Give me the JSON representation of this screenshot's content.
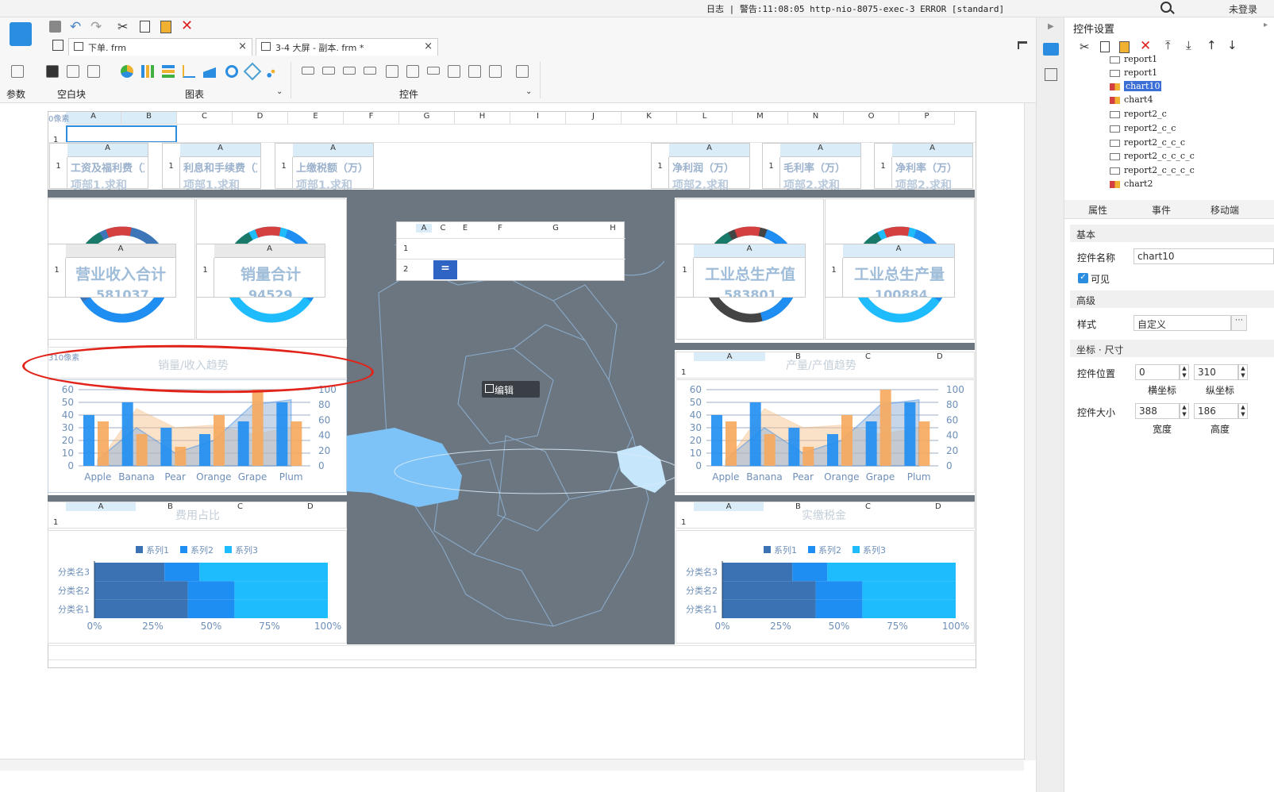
{
  "topbar": {
    "log": "日志 | 警告:11:08:05 http-nio-8075-exec-3 ERROR [standard]",
    "login": "未登录"
  },
  "tabs": [
    {
      "label": "下单. frm"
    },
    {
      "label": "3-4 大屏 - 副本. frm *"
    }
  ],
  "ribbon": {
    "params": "参数",
    "blank": "空白块",
    "charts": "图表",
    "controls": "控件"
  },
  "sheet": {
    "cols": [
      "A",
      "B",
      "C",
      "D",
      "E",
      "F",
      "G",
      "H",
      "I",
      "J",
      "K",
      "L",
      "M",
      "N",
      "O",
      "P"
    ],
    "top_label": "0像素",
    "row1": "1",
    "mini_tables_top": [
      {
        "h": "A",
        "r": "1",
        "t": "工资及福利费（万",
        "t2": "项部1.求和"
      },
      {
        "h": "A",
        "r": "1",
        "t": "利息和手续费（万",
        "t2": "项部1.求和"
      },
      {
        "h": "A",
        "r": "1",
        "t": "上缴税额（万）",
        "t2": "项部1.求和"
      },
      {
        "h": "A",
        "r": "1",
        "t": "净利润（万）",
        "t2": "项部2.求和"
      },
      {
        "h": "A",
        "r": "1",
        "t": "毛利率（万）",
        "t2": "项部2.求和"
      },
      {
        "h": "A",
        "r": "1",
        "t": "净利率（万）",
        "t2": "项部2.求和"
      }
    ],
    "kpis": [
      {
        "h": "A",
        "r1": "1",
        "r2": "2",
        "title": "营业收入合计",
        "value": "581037"
      },
      {
        "h": "A",
        "r1": "1",
        "r2": "2",
        "title": "销量合计",
        "value": "94529"
      },
      {
        "h": "A",
        "r1": "1",
        "r2": "2",
        "title": "工业总生产值",
        "value": "583801"
      },
      {
        "h": "A",
        "r1": "1",
        "r2": "2",
        "title": "工业总生产量",
        "value": "100884"
      }
    ],
    "center_table": {
      "cols": [
        "A",
        "C",
        "E",
        "F",
        "G",
        "H"
      ],
      "rows": [
        "1",
        "2"
      ],
      "cell": "="
    },
    "edit_button": "编辑",
    "label_310": "310像素",
    "trend_left": "销量/收入趋势",
    "trend_right": "产量/产值趋势",
    "cost_left": "费用占比",
    "cost_right": "实缴税金",
    "hdr_small": {
      "a": "A",
      "b": "B",
      "c": "C",
      "d": "D",
      "r": "1"
    }
  },
  "combo_chart": {
    "categories": [
      "Apple",
      "Banana",
      "Pear",
      "Orange",
      "Grape",
      "Plum"
    ],
    "left_ticks": [
      "0",
      "10",
      "20",
      "30",
      "40",
      "50",
      "60"
    ],
    "right_ticks": [
      "0",
      "20",
      "40",
      "60",
      "80",
      "100"
    ]
  },
  "chart_data": [
    {
      "type": "bar",
      "categories": [
        "Apple",
        "Banana",
        "Pear",
        "Orange",
        "Grape",
        "Plum"
      ],
      "ylim": [
        0,
        60
      ],
      "y2lim": [
        0,
        100
      ],
      "series": [
        {
          "values": [
            40,
            50,
            30,
            25,
            35,
            50
          ],
          "color": "#1e8ef2"
        },
        {
          "values": [
            35,
            25,
            15,
            40,
            60,
            35
          ],
          "color": "#f6a95c"
        },
        {
          "values": [
            2,
            45,
            30,
            32,
            25,
            30
          ],
          "color": "#f6c08a"
        },
        {
          "values": [
            5,
            30,
            10,
            20,
            48,
            52
          ],
          "color": "#3d8ae6"
        }
      ]
    },
    {
      "type": "bar",
      "categories": [
        "分类名3",
        "分类名2",
        "分类名1"
      ],
      "stacked": "percent",
      "legend": [
        "系列1",
        "系列2",
        "系列3"
      ],
      "x_ticks": [
        "0%",
        "25%",
        "50%",
        "75%",
        "100%"
      ],
      "series": [
        {
          "name": "系列1",
          "values": [
            30,
            40,
            40
          ],
          "color": "#3b72b4"
        },
        {
          "name": "系列2",
          "values": [
            15,
            20,
            20
          ],
          "color": "#1e8ef2"
        },
        {
          "name": "系列3",
          "values": [
            55,
            40,
            40
          ],
          "color": "#1ebcfc"
        }
      ]
    }
  ],
  "panel": {
    "title": "控件设置",
    "tree": [
      "report1",
      "report1",
      "chart10",
      "chart4",
      "report2_c",
      "report2_c_c",
      "report2_c_c_c",
      "report2_c_c_c_c",
      "report2_c_c_c_c",
      "chart2"
    ],
    "subtabs": [
      "属性",
      "事件",
      "移动端"
    ],
    "basic": "基本",
    "name_label": "控件名称",
    "name_value": "chart10",
    "visible": "可见",
    "advanced": "高级",
    "style_label": "样式",
    "style_value": "自定义",
    "coord": "坐标 · 尺寸",
    "pos_label": "控件位置",
    "pos_x": "0",
    "pos_y": "310",
    "x_label": "横坐标",
    "y_label": "纵坐标",
    "size_label": "控件大小",
    "w": "388",
    "h": "186",
    "w_label": "宽度",
    "h_label": "高度"
  }
}
